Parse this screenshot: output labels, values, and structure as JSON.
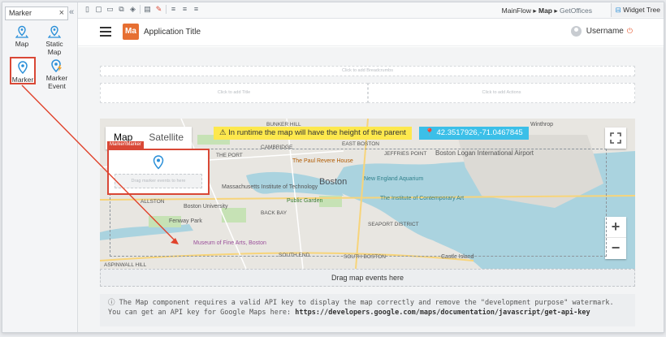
{
  "palette": {
    "search_value": "Marker",
    "items": [
      {
        "label": "Map",
        "icon": "map-pin-icon"
      },
      {
        "label": "Static Map",
        "icon": "map-pin-icon"
      },
      {
        "label": "Marker",
        "icon": "marker-icon",
        "selected": true
      },
      {
        "label": "Marker Event",
        "icon": "marker-event-icon"
      }
    ]
  },
  "toolbar": {
    "breadcrumb": [
      "MainFlow",
      "Map",
      "GetOffices"
    ],
    "widget_tree": "Widget Tree"
  },
  "app": {
    "logo_text": "Ma",
    "title": "Application Title",
    "username": "Username",
    "breadcrumbs_placeholder": "Click to add Breadcrumbs",
    "title_placeholder": "Click to add Title",
    "actions_placeholder": "Click to add Actions"
  },
  "map": {
    "type_map": "Map",
    "type_satellite": "Satellite",
    "banner": "In runtime the map will have the height of the parent",
    "coords": "42.3517926,-71.0467845",
    "marker_tag": "Marker\\Marker",
    "marker_drop": "Drag marker events to here",
    "zoom_in": "+",
    "zoom_out": "−",
    "labels": [
      "Boston",
      "EAST BOSTON",
      "JEFFRIES POINT",
      "Boston Logan International Airport",
      "THE PORT",
      "CAMBRIDGE",
      "Massachusetts Institute of Technology",
      "The Paul Revere House",
      "New England Aquarium",
      "The Institute of Contemporary Art",
      "Public Garden",
      "ALLSTON",
      "Boston University",
      "BACK BAY",
      "Fenway Park",
      "SEAPORT DISTRICT",
      "Museum of Fine Arts, Boston",
      "SOUTH END",
      "SOUTH BOSTON",
      "Castle Island",
      "ASPINWALL HILL",
      "BUNKER HILL",
      "Winthrop"
    ]
  },
  "events_drop": "Drag map events here",
  "note": {
    "text": "The Map component requires a valid API key to display the map correctly and remove the \"development purpose\" watermark. You can get an API key for Google Maps here:",
    "url": "https://developers.google.com/maps/documentation/javascript/get-api-key"
  },
  "colors": {
    "accent": "#e66f32",
    "selection": "#d94836",
    "banner": "#fde84d",
    "coords": "#3bbfe8"
  }
}
